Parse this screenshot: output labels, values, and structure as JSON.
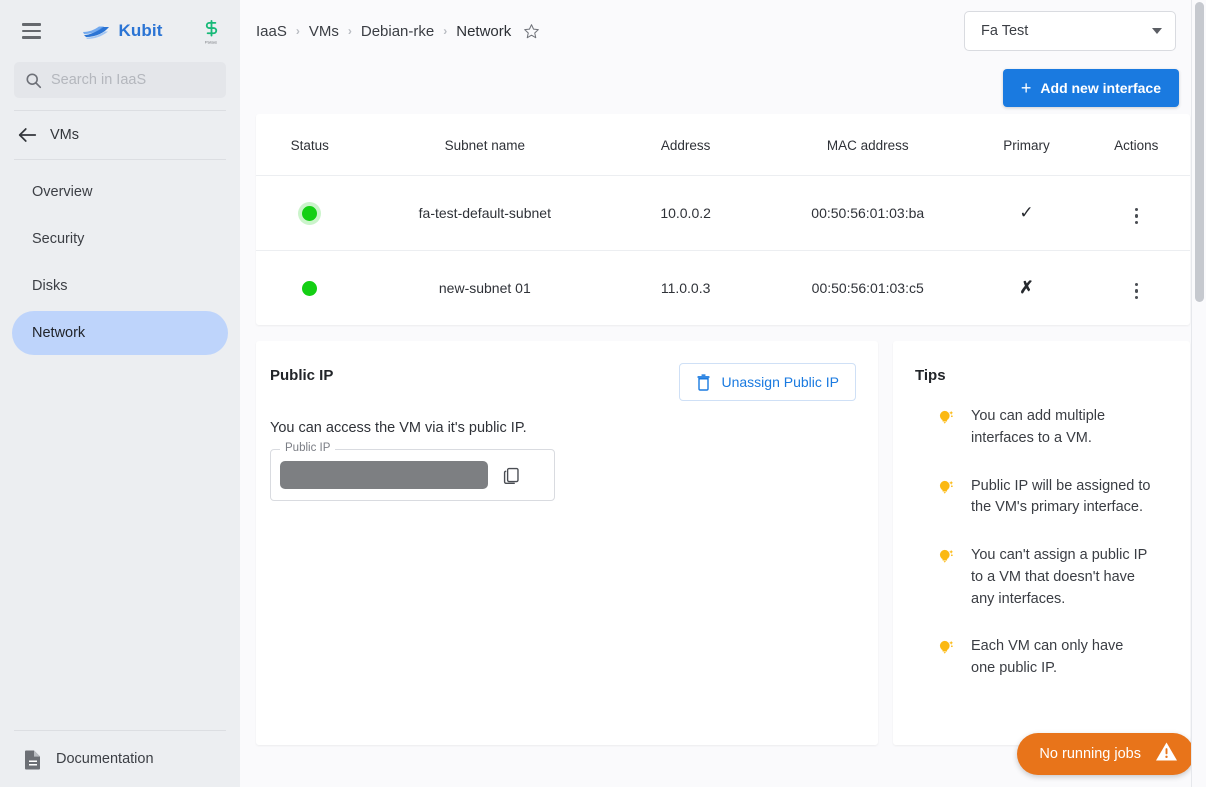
{
  "sidebar": {
    "menu_icon": "hamburger-icon",
    "brand_name": "Kubit",
    "brand_logo": "kubit-wave-logo",
    "company_logo": "company-s-logo",
    "search": {
      "placeholder": "Search in IaaS",
      "icon": "search-icon",
      "value": ""
    },
    "back": {
      "label": "VMs",
      "icon": "arrow-left-icon"
    },
    "items": [
      {
        "label": "Overview",
        "active": false
      },
      {
        "label": "Security",
        "active": false
      },
      {
        "label": "Disks",
        "active": false
      },
      {
        "label": "Network",
        "active": true
      }
    ],
    "documentation": {
      "label": "Documentation",
      "icon": "document-icon"
    },
    "active_color": "#bed4fb"
  },
  "topbar": {
    "breadcrumbs": [
      "IaaS",
      "VMs",
      "Debian-rke",
      "Network"
    ],
    "separator": "›",
    "favorite_icon": "star-outline-icon",
    "project_select": {
      "value": "Fa Test",
      "icon": "chevron-down-icon"
    }
  },
  "actions": {
    "add_interface": {
      "label": "Add new interface",
      "icon": "plus-icon",
      "color": "#1a7ae0"
    }
  },
  "table": {
    "columns": [
      "Status",
      "Subnet name",
      "Address",
      "MAC address",
      "Primary",
      "Actions"
    ],
    "rows": [
      {
        "status": "running",
        "status_color": "#14cf14",
        "subnet_name": "fa-test-default-subnet",
        "address": "10.0.0.2",
        "mac_address": "00:50:56:01:03:ba",
        "primary": "✓",
        "actions_icon": "kebab-menu-icon"
      },
      {
        "status": "running",
        "status_color": "#14cf14",
        "subnet_name": "new-subnet 01",
        "address": "11.0.0.3",
        "mac_address": "00:50:56:01:03:c5",
        "primary": "✗",
        "actions_icon": "kebab-menu-icon"
      }
    ]
  },
  "public_ip_panel": {
    "title": "Public IP",
    "unassign_button": {
      "label": "Unassign Public IP",
      "icon": "trash-icon"
    },
    "description": "You can access the VM via it's public IP.",
    "field_label": "Public IP",
    "field_value": "",
    "field_masked": true,
    "copy_icon": "copy-icon"
  },
  "tips_panel": {
    "title": "Tips",
    "tip_icon": "lightbulb-icon",
    "tips": [
      "You can add multiple interfaces to a VM.",
      "Public IP will be assigned to the VM's primary interface.",
      "You can't assign a public IP to a VM that doesn't have any interfaces.",
      "Each VM can only have one public IP."
    ]
  },
  "jobs_status": {
    "label": "No running jobs",
    "icon": "warning-triangle-icon",
    "color": "#e8741a"
  }
}
